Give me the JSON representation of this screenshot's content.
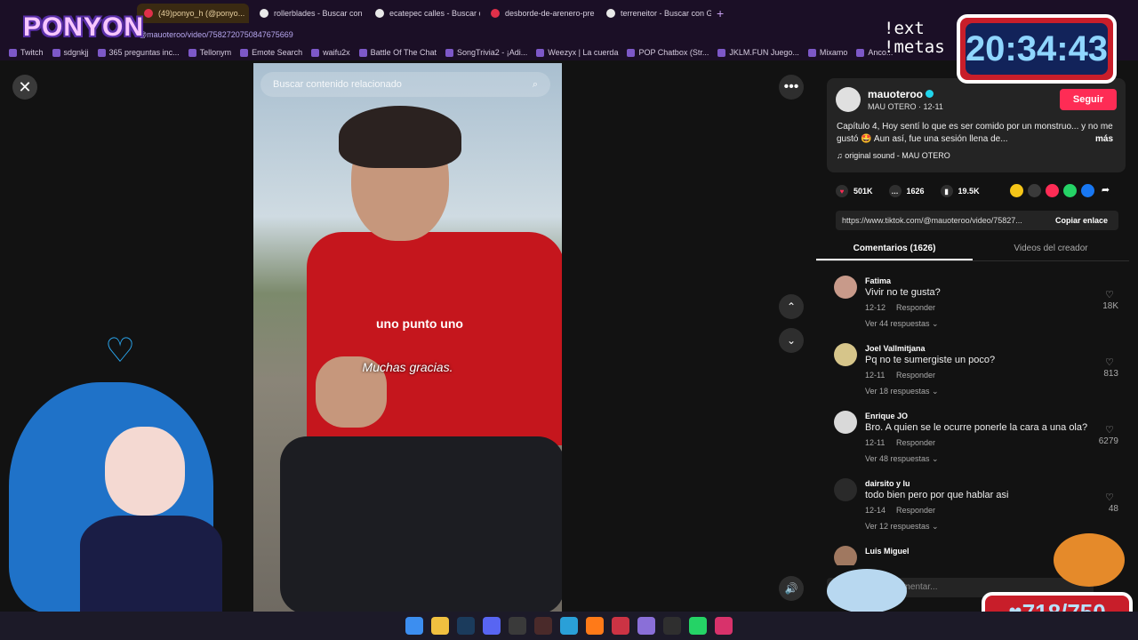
{
  "browser": {
    "tabs": [
      {
        "label": "(49)ponyo_h (@ponyo...",
        "active": true
      },
      {
        "label": "rollerblades - Buscar con G",
        "active": false
      },
      {
        "label": "ecatepec calles - Buscar c",
        "active": false
      },
      {
        "label": "desborde-de-arenero-pre",
        "active": false
      },
      {
        "label": "terreneitor - Buscar con G",
        "active": false
      }
    ],
    "new_tab": "+",
    "url": "@mauoteroo/video/7582720750847675669",
    "bookmarks": [
      "Twitch",
      "sdgnkjj",
      "365 preguntas inc...",
      "Tellonym",
      "Emote Search",
      "waifu2x",
      "Battle Of The Chat",
      "SongTrivia2 - ¡Adi...",
      "Weezyx | La cuerda",
      "POP Chatbox (Str...",
      "JKLM.FUN Juego...",
      "Mixamo",
      "Anco..."
    ]
  },
  "overlay": {
    "logo": "PONYON",
    "commands": [
      "!ext",
      "!metas"
    ],
    "clock": "20:34:43",
    "goal": "♥718/750"
  },
  "video": {
    "search_placeholder": "Buscar contenido relacionado",
    "caption": "Muchas gracias.",
    "shirt_text": "uno punto uno"
  },
  "icons": {
    "close": "✕",
    "more": "•••",
    "up": "⌃",
    "down": "⌄",
    "volume": "🔊",
    "search": "⌕"
  },
  "post": {
    "username": "mauoteroo",
    "subline": "MAU OTERO · 12-11",
    "follow": "Seguir",
    "description": "Capítulo 4, Hoy sentí lo que es ser comido por un monstruo... y no me gustó 🤩 Aun así, fue una sesión llena de...",
    "more": "más",
    "sound": "♫  original sound - MAU OTERO",
    "likes": "501K",
    "comments_count": "1626",
    "saves": "19.5K",
    "link": "https://www.tiktok.com/@mauoteroo/video/75827...",
    "copy_link": "Copiar enlace"
  },
  "tabs": {
    "comments": "Comentarios (1626)",
    "creator_videos": "Videos del creador"
  },
  "comments": [
    {
      "name": "Fatima",
      "text": "Vivir no te gusta?",
      "date": "12-12",
      "reply": "Responder",
      "replies": "Ver 44 respuestas ⌄",
      "likes": "18K"
    },
    {
      "name": "Joel Vallmitjana",
      "text": "Pq no te sumergiste un poco?",
      "date": "12-11",
      "reply": "Responder",
      "replies": "Ver 18 respuestas ⌄",
      "likes": "813"
    },
    {
      "name": "Enrique JO",
      "text": "Bro. A quien se le ocurre ponerle la cara a una ola?",
      "date": "12-11",
      "reply": "Responder",
      "replies": "Ver 48 respuestas ⌄",
      "likes": "6279"
    },
    {
      "name": "dairsito y lu",
      "text": "todo bien pero por que hablar asi",
      "date": "12-14",
      "reply": "Responder",
      "replies": "Ver 12 respuestas ⌄",
      "likes": "48"
    },
    {
      "name": "Luis Miguel",
      "text": "",
      "date": "",
      "reply": "",
      "replies": "",
      "likes": ""
    }
  ],
  "comment_input_placeholder": "omentar...",
  "taskbar_icons": [
    "windows-icon",
    "folder-icon",
    "steam-icon",
    "discord-icon",
    "openai-icon",
    "app-icon",
    "edge-icon",
    "firefox-icon",
    "vpn-icon",
    "visual-studio-icon",
    "obs-icon",
    "whatsapp-icon",
    "tiktok-live-icon"
  ]
}
